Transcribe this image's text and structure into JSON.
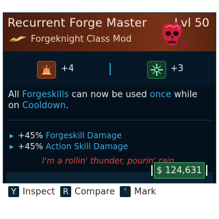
{
  "item": {
    "name": "Recurrent Forge Master",
    "level": "Lvl 50",
    "class_label": "Forgeknight Class Mod",
    "class_icon": "forgeknight-class-icon",
    "emblem_icon": "red-skull-emblem-icon",
    "rarity_color": "#6a2a14"
  },
  "stats": [
    {
      "icon": "forge-skill-icon",
      "value": "+4",
      "color": "#a04a22"
    },
    {
      "icon": "action-skill-icon",
      "value": "+3",
      "color": "#2a7a4a"
    }
  ],
  "description": {
    "part1": "All ",
    "highlight1": "Forgeskills",
    "part2": " can now be used ",
    "highlight2": "once",
    "part3": " while on ",
    "highlight3": "Cooldown",
    "part4": "."
  },
  "bonuses": [
    {
      "pct": "+45%",
      "label": "Forgeskill Damage"
    },
    {
      "pct": "+45%",
      "label": "Action Skill Damage"
    }
  ],
  "flavor_text": "I'm a rollin' thunder, pourin' rain.",
  "price": "$ 124,631",
  "actions": [
    {
      "key": "Y",
      "label": "Inspect"
    },
    {
      "key": "R",
      "label": "Compare"
    },
    {
      "key": "’",
      "label": "Mark"
    }
  ],
  "colors": {
    "panel": "#04101c",
    "highlight": "#3aaee0",
    "flavor": "#e0453a",
    "price": "#1d5838"
  }
}
